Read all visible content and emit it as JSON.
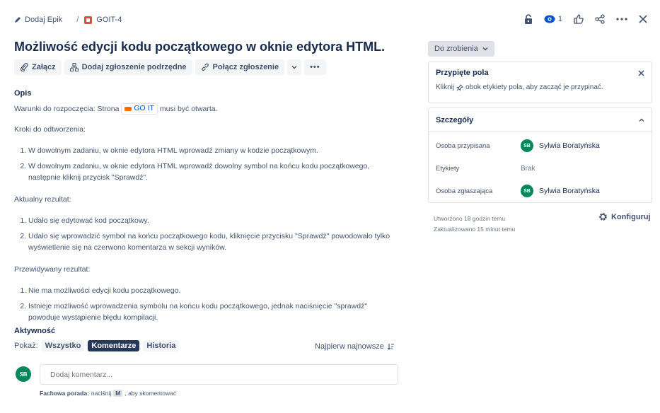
{
  "breadcrumb": {
    "epic_label": "Dodaj Epik",
    "separator": "/",
    "issue_key": "GOIT-4"
  },
  "header_actions": {
    "watchers_count": "1"
  },
  "issue": {
    "title": "Możliwość edycji kodu początkowego w oknie edytora HTML."
  },
  "toolbar": {
    "attach": "Załącz",
    "add_subtask": "Dodaj zgłoszenie podrzędne",
    "link_issue": "Połącz zgłoszenie",
    "more": "•••"
  },
  "description": {
    "label": "Opis",
    "preconditions_prefix": "Warunki do rozpoczęcia: Strona",
    "preconditions_link": "GO IT",
    "preconditions_suffix": "musi być otwarta.",
    "steps_label": "Kroki do odtworzenia:",
    "steps": [
      "W dowolnym zadaniu,  w oknie edytora HTML wprowadź zmiany w kodzie początkowym.",
      "W dowolnym zadaniu, w oknie edytora HTML wprowadź dowolny symbol na końcu kodu początkowego, następnie kliknij przycisk \"Sprawdź\"."
    ],
    "actual_label": "Aktualny rezultat:",
    "actual": [
      "Udało się edytować kod początkowy.",
      "Udało się wprowadzić symbol na końcu początkowego kodu, kliknięcie przycisku \"Sprawdź\" powodowało tylko wyświetlenie się na czerwono komentarza w sekcji wyników."
    ],
    "expected_label": "Przewidywany rezultat:",
    "expected": [
      "Nie ma możliwości edycji kodu początkowego.",
      "Istnieje możliwość wprowadzenia symbolu na końcu kodu początkowego, jednak naciśnięcie \"sprawdź\" powoduje wystąpienie błędu kompilacji."
    ]
  },
  "activity": {
    "label": "Aktywność",
    "show_label": "Pokaż:",
    "filters": [
      "Wszystko",
      "Komentarze",
      "Historia"
    ],
    "sort_label": "Najpierw najnowsze",
    "avatar_initials": "SB",
    "comment_placeholder": "Dodaj komentarz...",
    "tip_bold": "Fachowa porada:",
    "tip_press": "naciśnij",
    "tip_key": "M",
    "tip_suffix": ", aby skomentować"
  },
  "status": {
    "label": "Do zrobienia"
  },
  "pinned": {
    "title": "Przypięte pola",
    "text_prefix": "Kliknij",
    "text_suffix": "obok etykiety pola, aby zacząć je przypinać."
  },
  "details": {
    "title": "Szczegóły",
    "assignee_label": "Osoba przypisana",
    "assignee": "Sylwia Boratyńska",
    "labels_label": "Etykiety",
    "labels_value": "Brak",
    "reporter_label": "Osoba zgłaszająca",
    "reporter": "Sylwia Boratyńska",
    "avatar_initials": "SB"
  },
  "meta": {
    "created": "Utworzono 18 godzin temu",
    "updated": "Zaktualizowano 15 minut temu",
    "configure": "Konfiguruj"
  },
  "colors": {
    "accent": "#0052cc",
    "status_green": "#00875a",
    "issue_red": "#e5493a"
  }
}
